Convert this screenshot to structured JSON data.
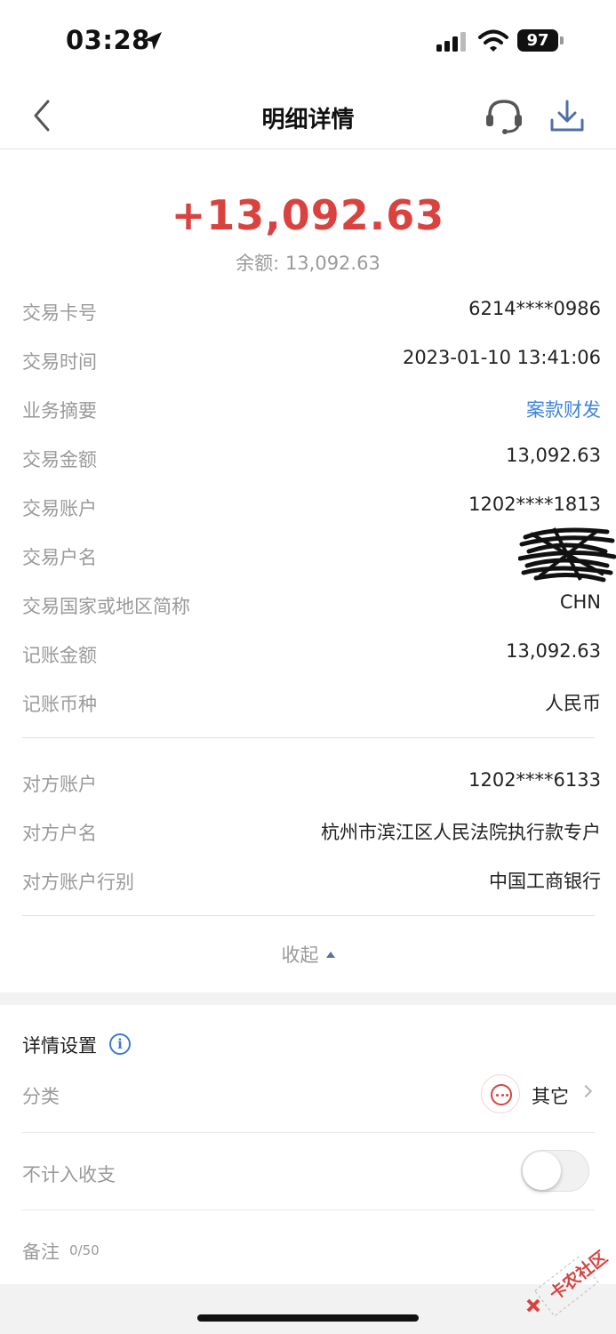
{
  "status_bar": {
    "time": "03:28",
    "battery": "97"
  },
  "nav": {
    "title": "明细详情"
  },
  "summary": {
    "amount": "+13,092.63",
    "balance_label": "余额:",
    "balance_value": "13,092.63"
  },
  "details": [
    {
      "label": "交易卡号",
      "value": "6214****0986"
    },
    {
      "label": "交易时间",
      "value": "2023-01-10 13:41:06"
    },
    {
      "label": "业务摘要",
      "value": "案款财发",
      "link": true
    },
    {
      "label": "交易金额",
      "value": "13,092.63"
    },
    {
      "label": "交易账户",
      "value": "1202****1813"
    },
    {
      "label": "交易户名",
      "value": ""
    },
    {
      "label": "交易国家或地区简称",
      "value": "CHN"
    },
    {
      "label": "记账金额",
      "value": "13,092.63"
    },
    {
      "label": "记账币种",
      "value": "人民币"
    }
  ],
  "counterparty": [
    {
      "label": "对方账户",
      "value": "1202****6133"
    },
    {
      "label": "对方户名",
      "value": "杭州市滨江区人民法院执行款专户"
    },
    {
      "label": "对方账户行别",
      "value": "中国工商银行"
    }
  ],
  "collapse_label": "收起",
  "settings": {
    "title": "详情设置",
    "category_label": "分类",
    "category_value": "其它",
    "exclude_label": "不计入收支",
    "exclude_on": false,
    "note_label": "备注",
    "note_count": "0/50"
  },
  "watermark": "卡农社区",
  "colors": {
    "amount": "#d9423e",
    "link": "#3f85d8",
    "label": "#9a9a9a"
  }
}
